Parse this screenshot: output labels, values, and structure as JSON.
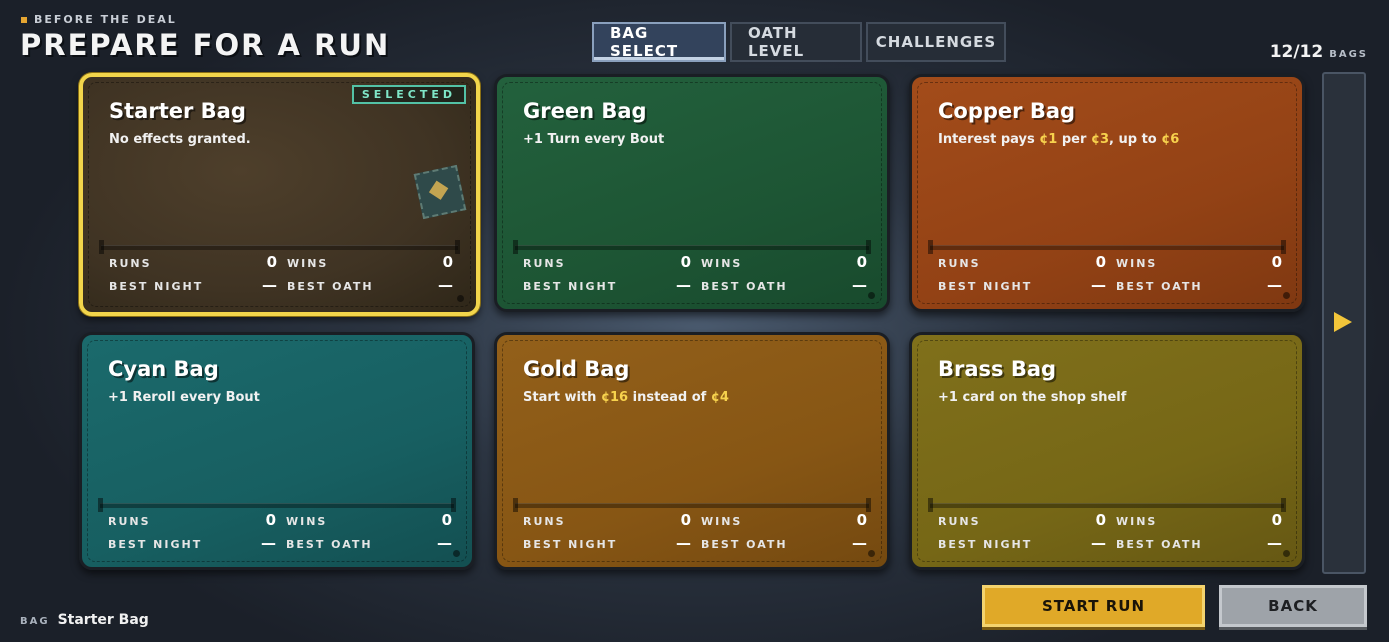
{
  "header": {
    "kicker": "BEFORE THE DEAL",
    "title": "PREPARE FOR A RUN"
  },
  "tabs": [
    {
      "label": "BAG SELECT",
      "active": true
    },
    {
      "label": "OATH LEVEL",
      "active": false
    },
    {
      "label": "CHALLENGES",
      "active": false
    }
  ],
  "bag_count": {
    "value": "12/12",
    "label": "BAGS"
  },
  "stat_labels": {
    "runs": "RUNS",
    "wins": "WINS",
    "best_night": "BEST NIGHT",
    "best_oath": "BEST OATH"
  },
  "cards": [
    {
      "name": "Starter Bag",
      "desc": "No effects granted.",
      "runs": "0",
      "wins": "0",
      "best_night": "—",
      "best_oath": "—",
      "selected": true,
      "badge": "SELECTED",
      "color": "#3f3323"
    },
    {
      "name": "Green Bag",
      "desc": "+1 Turn every Bout",
      "runs": "0",
      "wins": "0",
      "best_night": "—",
      "best_oath": "—",
      "color": "#1d5534"
    },
    {
      "name": "Copper Bag",
      "desc_parts": [
        "Interest pays ",
        "¢1",
        " per ",
        "¢3",
        ", up to ",
        "¢6"
      ],
      "runs": "0",
      "wins": "0",
      "best_night": "—",
      "best_oath": "—",
      "color": "#934215"
    },
    {
      "name": "Cyan Bag",
      "desc": "+1 Reroll every Bout",
      "runs": "0",
      "wins": "0",
      "best_night": "—",
      "best_oath": "—",
      "color": "#175f61"
    },
    {
      "name": "Gold Bag",
      "desc_parts": [
        "Start with ",
        "¢16",
        " instead of ",
        "¢4"
      ],
      "runs": "0",
      "wins": "0",
      "best_night": "—",
      "best_oath": "—",
      "color": "#875614"
    },
    {
      "name": "Brass Bag",
      "desc": "+1 card on the shop shelf",
      "runs": "0",
      "wins": "0",
      "best_night": "—",
      "best_oath": "—",
      "color": "#766716"
    }
  ],
  "footer": {
    "bag_label": "BAG",
    "bag_value": "Starter Bag"
  },
  "buttons": {
    "start": "START RUN",
    "back": "BACK"
  },
  "colors": {
    "accent": "#f2d54b",
    "highlight_currency": "#f7d24d",
    "start_button": "#e0a928"
  },
  "icons": {
    "next": "arrow-right-icon"
  }
}
